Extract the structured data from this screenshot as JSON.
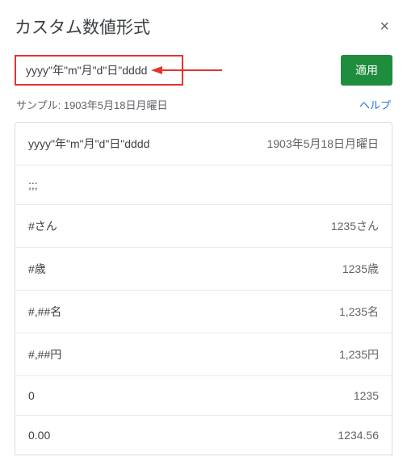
{
  "header": {
    "title": "カスタム数値形式",
    "close": "×"
  },
  "input": {
    "value": "yyyy\"年\"m\"月\"d\"日\"dddd"
  },
  "apply_label": "適用",
  "sample": {
    "prefix": "サンプル: ",
    "value": "1903年5月18日月曜日"
  },
  "help_label": "ヘルプ",
  "formats": [
    {
      "fmt": "yyyy\"年\"m\"月\"d\"日\"dddd",
      "example": "1903年5月18日月曜日"
    },
    {
      "fmt": ";;;",
      "example": ""
    },
    {
      "fmt": "#さん",
      "example": "1235さん"
    },
    {
      "fmt": "#歳",
      "example": "1235歳"
    },
    {
      "fmt": "#,##名",
      "example": "1,235名"
    },
    {
      "fmt": "#,##円",
      "example": "1,235円"
    },
    {
      "fmt": "0",
      "example": "1235"
    },
    {
      "fmt": "0.00",
      "example": "1234.56"
    }
  ],
  "colors": {
    "highlight_border": "#e3342f",
    "apply_bg": "#1e8e3e",
    "link": "#1a73e8"
  }
}
